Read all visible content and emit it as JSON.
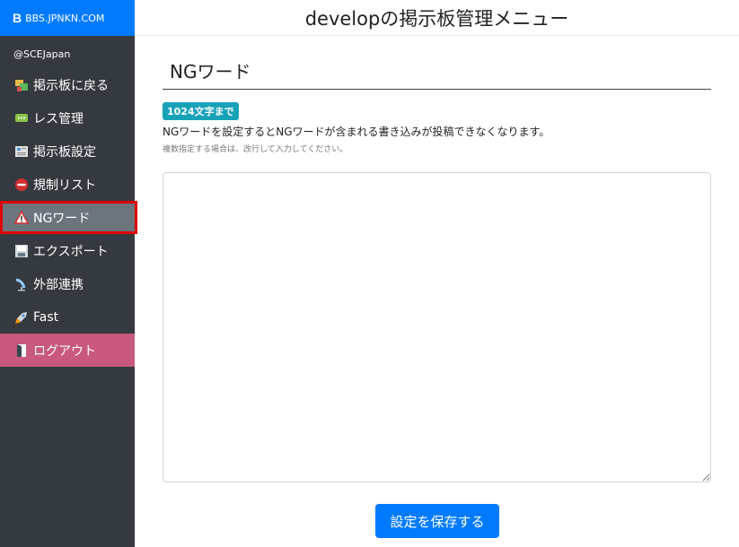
{
  "brand": {
    "logo_letter": "B",
    "name": "BBS.JPNKN.COM"
  },
  "user": "@SCEJapan",
  "nav": [
    {
      "label": "掲示板に戻る",
      "icon": "board-icon"
    },
    {
      "label": "レス管理",
      "icon": "chat-icon"
    },
    {
      "label": "掲示板設定",
      "icon": "settings-doc-icon"
    },
    {
      "label": "規制リスト",
      "icon": "no-entry-icon"
    },
    {
      "label": "NGワード",
      "icon": "warning-icon"
    },
    {
      "label": "エクスポート",
      "icon": "floppy-icon"
    },
    {
      "label": "外部連携",
      "icon": "satellite-icon"
    },
    {
      "label": "Fast",
      "icon": "rocket-icon"
    },
    {
      "label": "ログアウト",
      "icon": "door-icon"
    }
  ],
  "header": {
    "title": "developの掲示板管理メニュー"
  },
  "main": {
    "section_title": "NGワード",
    "limit_badge": "1024文字まで",
    "description": "NGワードを設定するとNGワードが含まれる書き込みが投稿できなくなります。",
    "note": "複数指定する場合は、改行して入力してください。",
    "textarea_value": "",
    "save_label": "設定を保存する"
  },
  "colors": {
    "sidebar": "#343a40",
    "brand": "#007bff",
    "active": "#6c757d",
    "logout": "#c8587e",
    "badge": "#17a2b8"
  }
}
